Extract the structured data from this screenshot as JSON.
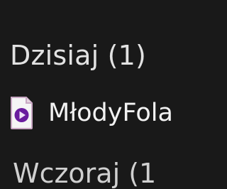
{
  "groups": [
    {
      "header": "Dzisiaj (1)",
      "items": [
        {
          "name": "MłodyFola",
          "icon": "video-file-icon"
        }
      ]
    },
    {
      "header": "Wczoraj (1"
    }
  ],
  "colors": {
    "background": "#191919",
    "header_text": "#e2e2e2",
    "item_text": "#f2f2f2",
    "icon_accent": "#6a1d9e"
  }
}
